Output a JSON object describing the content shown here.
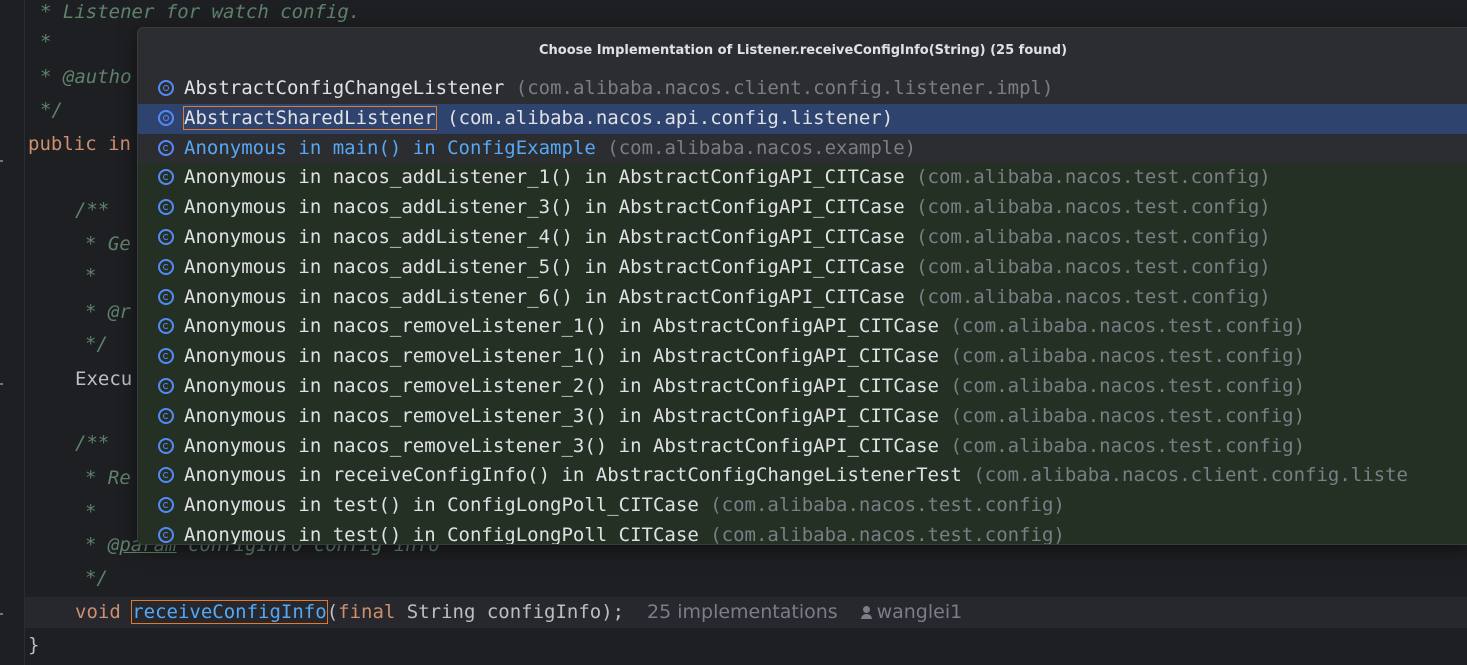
{
  "editor": {
    "line1": "* Listener for watch config.",
    "line2": "*",
    "line3": "* @autho",
    "line4": "*/",
    "line5_kw": "public",
    "line5_rest": "in",
    "line7": "/**",
    "line8": "* Ge",
    "line9": "*",
    "line10": "* @r",
    "line11": "*/",
    "line12": "Execu",
    "line14": "/**",
    "line15": "* Re",
    "line16": "*",
    "line17_tag": "@param",
    "line17_rest": " configInfo config info",
    "line18": "*/",
    "void": "void",
    "method": "receiveConfigInfo",
    "params_kw": "final",
    "params_rest": " String configInfo);",
    "implementations": "25 implementations",
    "author": "wanglei1",
    "close_brace": "}"
  },
  "popup": {
    "title": "Choose Implementation of Listener.receiveConfigInfo(String) (25 found)",
    "items": [
      {
        "name": "AbstractConfigChangeListener",
        "pkg": "(com.alibaba.nacos.client.config.listener.impl)"
      },
      {
        "name": "AbstractSharedListener",
        "pkg": "(com.alibaba.nacos.api.config.listener)"
      },
      {
        "name": "Anonymous in main() in ConfigExample",
        "pkg": "(com.alibaba.nacos.example)"
      },
      {
        "name": "Anonymous in nacos_addListener_1() in AbstractConfigAPI_CITCase",
        "pkg": "(com.alibaba.nacos.test.config)"
      },
      {
        "name": "Anonymous in nacos_addListener_3() in AbstractConfigAPI_CITCase",
        "pkg": "(com.alibaba.nacos.test.config)"
      },
      {
        "name": "Anonymous in nacos_addListener_4() in AbstractConfigAPI_CITCase",
        "pkg": "(com.alibaba.nacos.test.config)"
      },
      {
        "name": "Anonymous in nacos_addListener_5() in AbstractConfigAPI_CITCase",
        "pkg": "(com.alibaba.nacos.test.config)"
      },
      {
        "name": "Anonymous in nacos_addListener_6() in AbstractConfigAPI_CITCase",
        "pkg": "(com.alibaba.nacos.test.config)"
      },
      {
        "name": "Anonymous in nacos_removeListener_1() in AbstractConfigAPI_CITCase",
        "pkg": "(com.alibaba.nacos.test.config)"
      },
      {
        "name": "Anonymous in nacos_removeListener_1() in AbstractConfigAPI_CITCase",
        "pkg": "(com.alibaba.nacos.test.config)"
      },
      {
        "name": "Anonymous in nacos_removeListener_2() in AbstractConfigAPI_CITCase",
        "pkg": "(com.alibaba.nacos.test.config)"
      },
      {
        "name": "Anonymous in nacos_removeListener_3() in AbstractConfigAPI_CITCase",
        "pkg": "(com.alibaba.nacos.test.config)"
      },
      {
        "name": "Anonymous in nacos_removeListener_3() in AbstractConfigAPI_CITCase",
        "pkg": "(com.alibaba.nacos.test.config)"
      },
      {
        "name": "Anonymous in receiveConfigInfo() in AbstractConfigChangeListenerTest",
        "pkg": "(com.alibaba.nacos.client.config.liste"
      },
      {
        "name": "Anonymous in test() in ConfigLongPoll_CITCase",
        "pkg": "(com.alibaba.nacos.test.config)"
      },
      {
        "name": "Anonymous in test() in ConfigLongPoll_CITCase",
        "pkg": "(com.alibaba.nacos.test.config)"
      }
    ]
  },
  "colors": {
    "background": "#1e1f22",
    "popup_bg": "#2b2d30",
    "selection": "#2e436e",
    "test_row": "#253024",
    "highlight_outline": "#e07a2f"
  }
}
